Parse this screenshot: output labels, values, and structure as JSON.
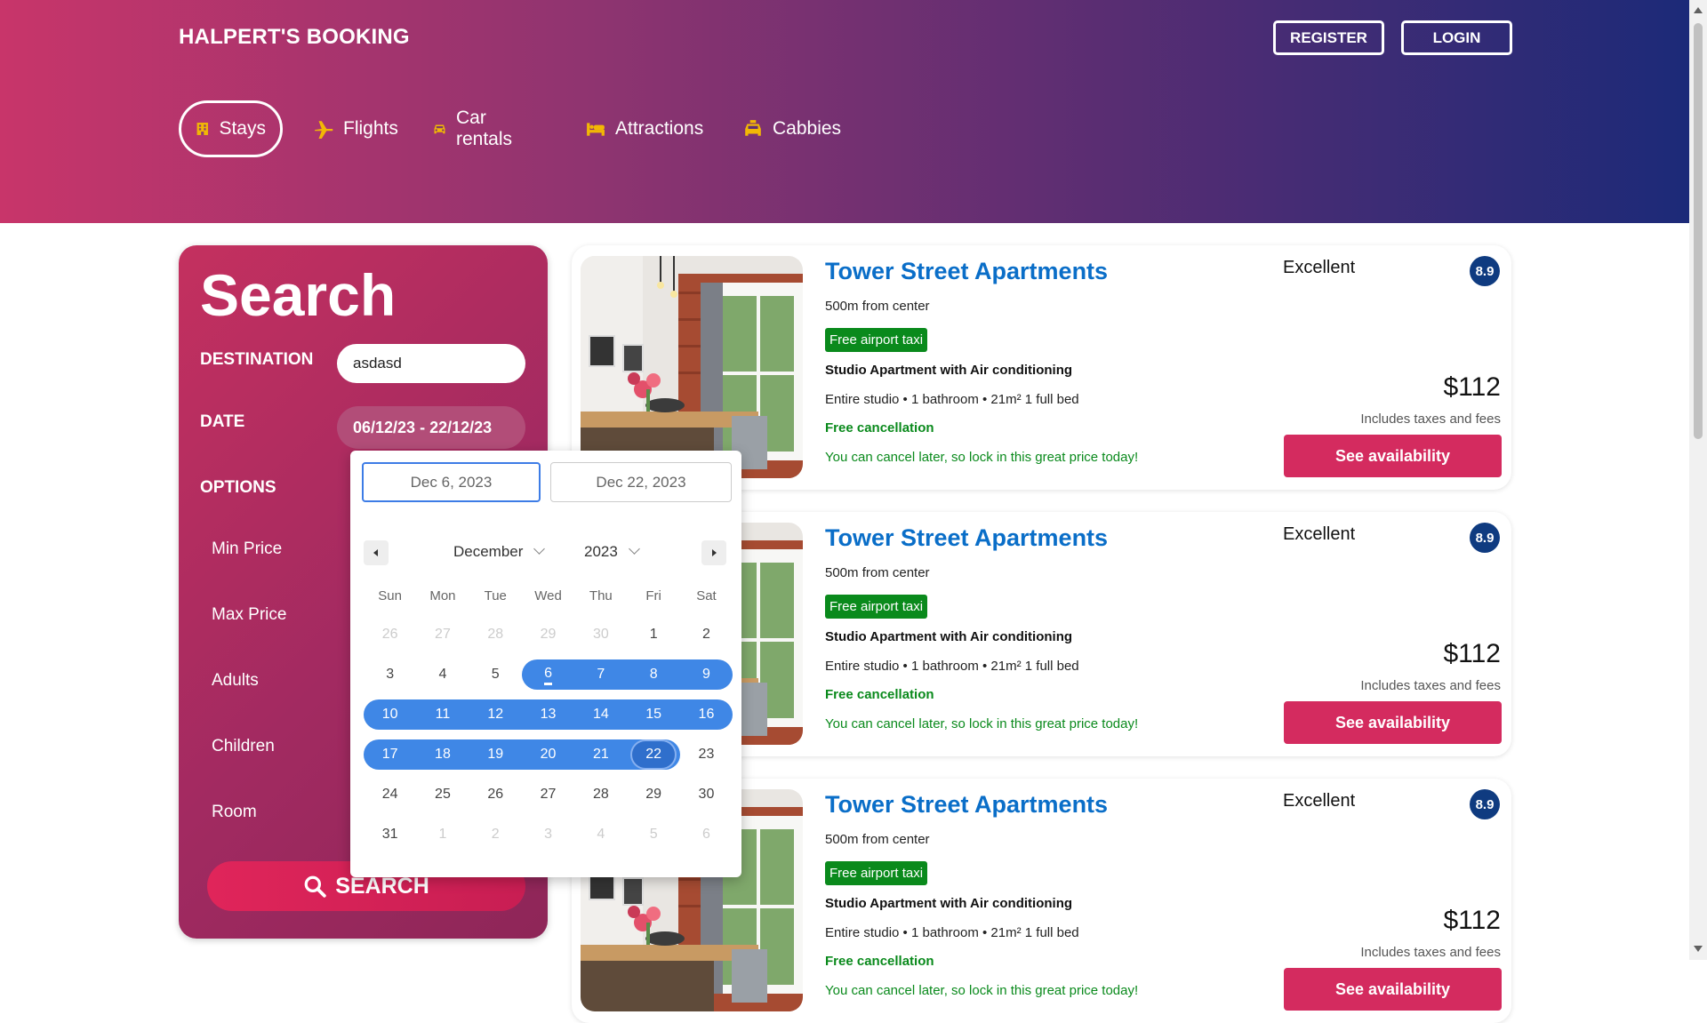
{
  "header": {
    "logo": "HALPERT'S BOOKING",
    "register_label": "REGISTER",
    "login_label": "LOGIN",
    "nav": [
      {
        "label": "Stays",
        "icon": "building-icon",
        "active": true
      },
      {
        "label": "Flights",
        "icon": "plane-icon"
      },
      {
        "label": "Car rentals",
        "icon": "car-icon"
      },
      {
        "label": "Attractions",
        "icon": "bed-icon"
      },
      {
        "label": "Cabbies",
        "icon": "taxi-icon"
      }
    ]
  },
  "search": {
    "title": "Search",
    "destination_label": "DESTINATION",
    "destination_value": "asdasd",
    "date_label": "DATE",
    "date_value": "06/12/23 - 22/12/23",
    "options_label": "OPTIONS",
    "options": [
      "Min Price",
      "Max Price",
      "Adults",
      "Children",
      "Room"
    ],
    "button_label": "SEARCH"
  },
  "datepicker": {
    "start_field": "Dec 6, 2023",
    "end_field": "Dec 22, 2023",
    "month": "December",
    "year": "2023",
    "weekdays": [
      "Sun",
      "Mon",
      "Tue",
      "Wed",
      "Thu",
      "Fri",
      "Sat"
    ],
    "weeks": [
      [
        "26",
        "27",
        "28",
        "29",
        "30",
        "1",
        "2"
      ],
      [
        "3",
        "4",
        "5",
        "6",
        "7",
        "8",
        "9"
      ],
      [
        "10",
        "11",
        "12",
        "13",
        "14",
        "15",
        "16"
      ],
      [
        "17",
        "18",
        "19",
        "20",
        "21",
        "22",
        "23"
      ],
      [
        "24",
        "25",
        "26",
        "27",
        "28",
        "29",
        "30"
      ],
      [
        "31",
        "1",
        "2",
        "3",
        "4",
        "5",
        "6"
      ]
    ]
  },
  "results": [
    {
      "name": "Tower Street Apartments",
      "distance": "500m from center",
      "taxi": "Free airport taxi",
      "subtitle": "Studio Apartment with Air conditioning",
      "features": "Entire studio • 1 bathroom • 21m² 1 full bed",
      "cancel": "Free cancellation",
      "cancel_sub": "You can cancel later, so lock in this great price today!",
      "rating_text": "Excellent",
      "rating": "8.9",
      "price": "$112",
      "taxes": "Includes taxes and fees",
      "button": "See availability"
    },
    {
      "name": "Tower Street Apartments",
      "distance": "500m from center",
      "taxi": "Free airport taxi",
      "subtitle": "Studio Apartment with Air conditioning",
      "features": "Entire studio • 1 bathroom • 21m² 1 full bed",
      "cancel": "Free cancellation",
      "cancel_sub": "You can cancel later, so lock in this great price today!",
      "rating_text": "Excellent",
      "rating": "8.9",
      "price": "$112",
      "taxes": "Includes taxes and fees",
      "button": "See availability"
    },
    {
      "name": "Tower Street Apartments",
      "distance": "500m from center",
      "taxi": "Free airport taxi",
      "subtitle": "Studio Apartment with Air conditioning",
      "features": "Entire studio • 1 bathroom • 21m² 1 full bed",
      "cancel": "Free cancellation",
      "cancel_sub": "You can cancel later, so lock in this great price today!",
      "rating_text": "Excellent",
      "rating": "8.9",
      "price": "$112",
      "taxes": "Includes taxes and fees",
      "button": "See availability"
    }
  ],
  "colors": {
    "accent": "#d42b5f",
    "link_blue": "#0a6ec8",
    "green": "#0a8a1c",
    "range_blue": "#3f87e6",
    "rating_badge": "#0f3b80"
  }
}
